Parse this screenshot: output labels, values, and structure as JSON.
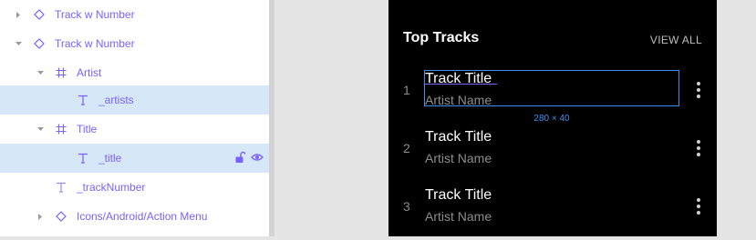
{
  "layers": [
    {
      "label": "Track w Number",
      "icon": "component-instance-icon",
      "expand": "collapsed",
      "selected": false
    },
    {
      "label": "Track w Number",
      "icon": "component-instance-icon",
      "expand": "expanded",
      "selected": false
    },
    {
      "label": "Artist",
      "icon": "frame-icon",
      "expand": "expanded",
      "selected": false
    },
    {
      "label": "_artists",
      "icon": "text-icon",
      "expand": "none",
      "selected": true
    },
    {
      "label": "Title",
      "icon": "frame-icon",
      "expand": "expanded",
      "selected": false
    },
    {
      "label": "_title",
      "icon": "text-icon",
      "expand": "none",
      "selected": true
    },
    {
      "label": "_trackNumber",
      "icon": "text-icon",
      "expand": "none",
      "selected": false
    },
    {
      "label": "Icons/Android/Action Menu",
      "icon": "component-instance-icon",
      "expand": "collapsed",
      "selected": false
    }
  ],
  "header": {
    "title": "Top Tracks",
    "action": "VIEW ALL"
  },
  "tracks": [
    {
      "number": "1",
      "title": "Track Title",
      "artist": "Artist Name"
    },
    {
      "number": "2",
      "title": "Track Title",
      "artist": "Artist Name"
    },
    {
      "number": "3",
      "title": "Track Title",
      "artist": "Artist Name"
    }
  ],
  "selection": {
    "dimensions": "280 × 40"
  },
  "colors": {
    "accent": "#7b61ff",
    "selection": "#3c8ff0",
    "selected_row_bg": "#d6e7f7",
    "frame_bg": "#000000"
  }
}
